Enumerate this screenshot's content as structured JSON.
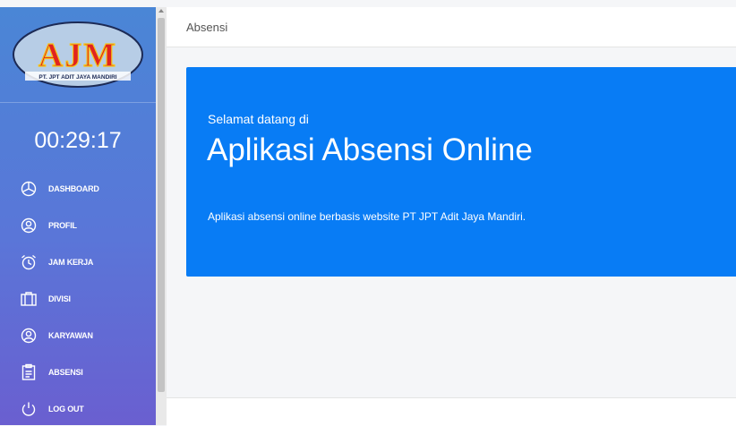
{
  "brand": {
    "logo_letters": "AJM",
    "logo_subtext": "PT. JPT ADIT JAYA MANDIRI",
    "colors": {
      "logo_red": "#e0231f",
      "logo_yellow": "#f5c51a",
      "logo_oval": "#b7cde6"
    }
  },
  "clock": "00:29:17",
  "menu": [
    {
      "label": "DASHBOARD",
      "icon": "dashboard-icon"
    },
    {
      "label": "PROFIL",
      "icon": "user-icon"
    },
    {
      "label": "JAM KERJA",
      "icon": "alarm-clock-icon"
    },
    {
      "label": "DIVISI",
      "icon": "briefcase-icon"
    },
    {
      "label": "KARYAWAN",
      "icon": "user-icon"
    },
    {
      "label": "ABSENSI",
      "icon": "clipboard-icon"
    },
    {
      "label": "LOG OUT",
      "icon": "power-icon"
    }
  ],
  "page": {
    "title": "Absensi"
  },
  "hero": {
    "welcome": "Selamat datang di",
    "title": "Aplikasi Absensi Online",
    "description": "Aplikasi absensi online berbasis website PT JPT Adit Jaya Mandiri."
  },
  "colors": {
    "hero_bg": "#087cf5",
    "sidebar_top": "#4a86d6",
    "sidebar_bottom": "#6a5fd0"
  }
}
